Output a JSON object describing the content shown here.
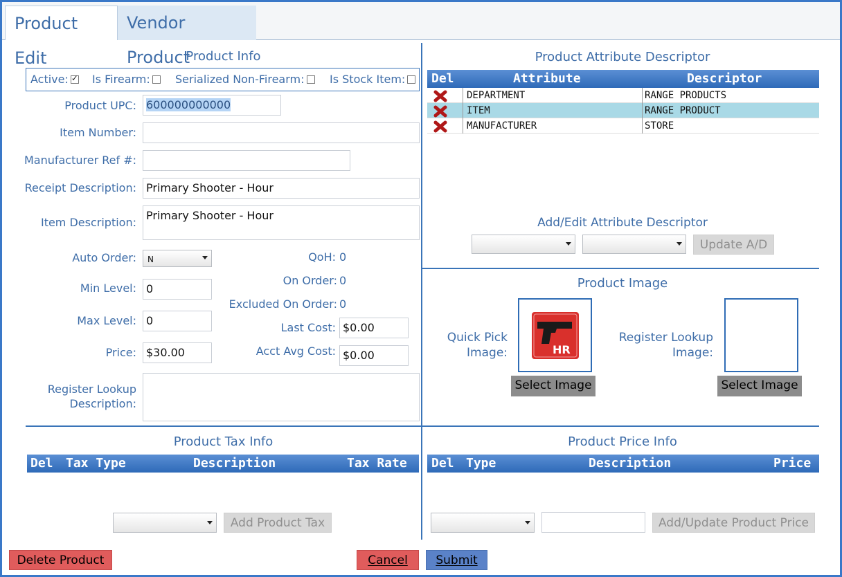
{
  "tabs": [
    {
      "label": "Product Edit"
    },
    {
      "label": "Vendor Product"
    }
  ],
  "product_info": {
    "heading": "Product Info",
    "checkboxes": [
      {
        "label": "Active:",
        "checked": true
      },
      {
        "label": "Is Firearm:",
        "checked": false
      },
      {
        "label": "Serialized Non-Firearm:",
        "checked": false
      },
      {
        "label": "Is Stock Item:",
        "checked": false
      }
    ],
    "upc_label": "Product UPC:",
    "upc_value": "600000000000",
    "item_number_label": "Item Number:",
    "item_number_value": "",
    "mfr_ref_label": "Manufacturer Ref #:",
    "mfr_ref_value": "",
    "receipt_desc_label": "Receipt Description:",
    "receipt_desc_value": "Primary Shooter - Hour",
    "item_desc_label": "Item Description:",
    "item_desc_value": "Primary Shooter - Hour",
    "auto_order_label": "Auto Order:",
    "auto_order_value": "N",
    "min_level_label": "Min Level:",
    "min_level_value": "0",
    "max_level_label": "Max Level:",
    "max_level_value": "0",
    "price_label": "Price:",
    "price_value": "$30.00",
    "qoh_label": "QoH:",
    "qoh_value": "0",
    "on_order_label": "On Order:",
    "on_order_value": "0",
    "excluded_label": "Excluded On Order:",
    "excluded_value": "0",
    "last_cost_label": "Last Cost:",
    "last_cost_value": "$0.00",
    "acct_avg_label": "Acct Avg Cost:",
    "acct_avg_value": "$0.00",
    "reg_lookup_label_1": "Register Lookup",
    "reg_lookup_label_2": "Description:",
    "reg_lookup_value": ""
  },
  "attributes": {
    "heading": "Product Attribute Descriptor",
    "columns": [
      "Del",
      "Attribute",
      "Descriptor"
    ],
    "rows": [
      {
        "attribute": "DEPARTMENT",
        "descriptor": "RANGE PRODUCTS"
      },
      {
        "attribute": "ITEM",
        "descriptor": "RANGE PRODUCT"
      },
      {
        "attribute": "MANUFACTURER",
        "descriptor": "STORE"
      }
    ],
    "add_edit_heading": "Add/Edit Attribute Descriptor",
    "update_label": "Update A/D"
  },
  "product_image": {
    "heading": "Product Image",
    "quick_pick_label_1": "Quick Pick",
    "quick_pick_label_2": "Image:",
    "register_label_1": "Register Lookup",
    "register_label_2": "Image:",
    "thumb_text": "HR",
    "select_label": "Select Image"
  },
  "tax": {
    "heading": "Product Tax Info",
    "columns": [
      "Del",
      "Tax Type",
      "Description",
      "Tax Rate"
    ],
    "add_label": "Add Product Tax"
  },
  "price_info": {
    "heading": "Product Price Info",
    "columns": [
      "Del",
      "Type",
      "Description",
      "Price"
    ],
    "add_label": "Add/Update Product Price"
  },
  "footer": {
    "delete_label": "Delete Product",
    "cancel_label": "Cancel",
    "submit_label": "Submit"
  },
  "colors": {
    "accent": "#3a74b8",
    "label": "#3e6da8",
    "delete": "#e05c5c",
    "submit": "#5a82c8"
  }
}
